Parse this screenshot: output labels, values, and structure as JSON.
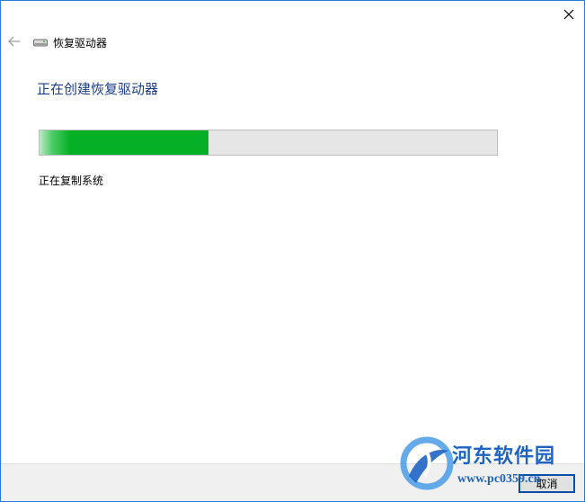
{
  "window": {
    "title": "恢复驱动器",
    "close_glyph": "✕",
    "accent_border": "#2b7bd8"
  },
  "content": {
    "heading": "正在创建恢复驱动器",
    "status_text": "正在复制系统",
    "progress_percent": 37,
    "progress_color": "#06b025"
  },
  "footer": {
    "cancel_label": "取消"
  },
  "watermark": {
    "title": "河东软件园",
    "url": "www.pc0359.cn"
  },
  "icons": {
    "back": "back-arrow-icon",
    "drive": "drive-icon",
    "close": "close-icon"
  }
}
